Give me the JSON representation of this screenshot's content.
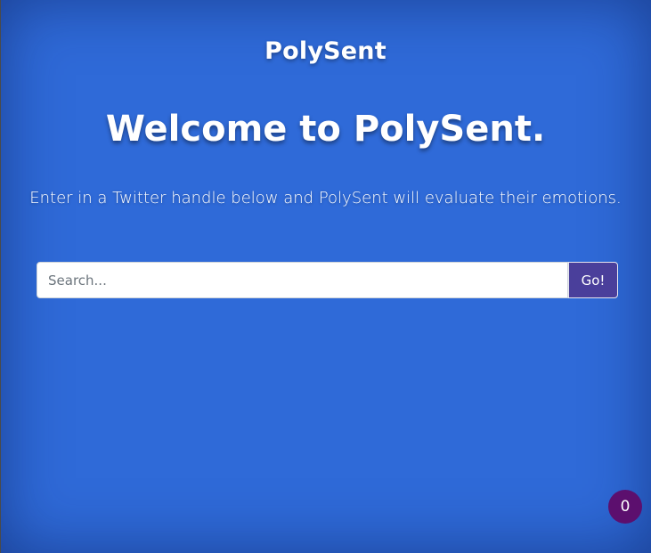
{
  "header": {
    "brand": "PolySent"
  },
  "hero": {
    "headline": "Welcome to PolySent.",
    "subtitle": "Enter in a Twitter handle below and PolySent will evaluate their emotions."
  },
  "search": {
    "placeholder": "Search...",
    "value": "",
    "button_label": "Go!"
  },
  "badge": {
    "count": "0"
  },
  "colors": {
    "background": "#2f6ad8",
    "button": "#4a3f9b",
    "badge": "#5c0f6e"
  }
}
